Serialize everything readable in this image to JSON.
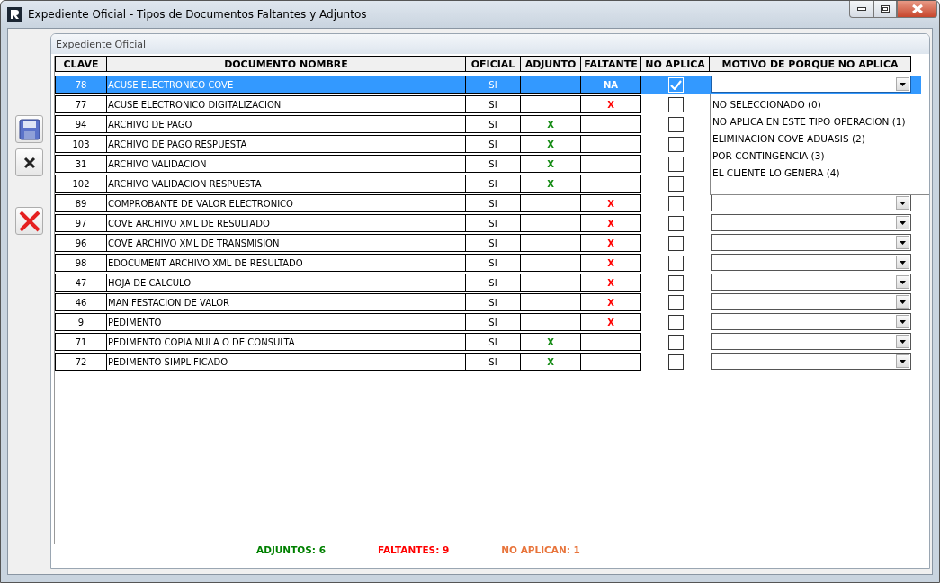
{
  "window": {
    "title": "Expediente Oficial - Tipos de Documentos Faltantes y Adjuntos"
  },
  "panel": {
    "title": "Expediente Oficial"
  },
  "table": {
    "columns": [
      "CLAVE",
      "DOCUMENTO NOMBRE",
      "OFICIAL",
      "ADJUNTO",
      "FALTANTE",
      "NO APLICA",
      "MOTIVO DE PORQUE NO APLICA"
    ],
    "rows": [
      {
        "clave": "78",
        "nombre": "ACUSE ELECTRONICO COVE",
        "oficial": "SI",
        "faltante": "NA",
        "no_aplica": true,
        "selected": true,
        "motivo": {
          "expanded": true,
          "options": [
            "NO SELECCIONADO (0)",
            "NO APLICA EN ESTE TIPO OPERACION (1)",
            "ELIMINACION COVE ADUASIS (2)",
            "POR CONTINGENCIA (3)",
            "EL CLIENTE LO GENERA (4)"
          ]
        }
      },
      {
        "clave": "77",
        "nombre": "ACUSE ELECTRONICO DIGITALIZACION",
        "oficial": "SI",
        "faltante": "X",
        "no_aplica": false,
        "selected": false
      },
      {
        "clave": "94",
        "nombre": "ARCHIVO DE PAGO",
        "oficial": "SI",
        "adjunto": "X",
        "no_aplica": false,
        "selected": false
      },
      {
        "clave": "103",
        "nombre": "ARCHIVO DE PAGO RESPUESTA",
        "oficial": "SI",
        "adjunto": "X",
        "no_aplica": false,
        "selected": false
      },
      {
        "clave": "31",
        "nombre": "ARCHIVO VALIDACION",
        "oficial": "SI",
        "adjunto": "X",
        "no_aplica": false,
        "selected": false
      },
      {
        "clave": "102",
        "nombre": "ARCHIVO VALIDACION RESPUESTA",
        "oficial": "SI",
        "adjunto": "X",
        "no_aplica": false,
        "selected": false
      },
      {
        "clave": "89",
        "nombre": "COMPROBANTE DE VALOR ELECTRONICO",
        "oficial": "SI",
        "faltante": "X",
        "no_aplica": false,
        "selected": false
      },
      {
        "clave": "97",
        "nombre": "COVE ARCHIVO XML DE RESULTADO",
        "oficial": "SI",
        "faltante": "X",
        "no_aplica": false,
        "selected": false
      },
      {
        "clave": "96",
        "nombre": "COVE ARCHIVO XML DE TRANSMISION",
        "oficial": "SI",
        "faltante": "X",
        "no_aplica": false,
        "selected": false
      },
      {
        "clave": "98",
        "nombre": "EDOCUMENT ARCHIVO XML DE RESULTADO",
        "oficial": "SI",
        "faltante": "X",
        "no_aplica": false,
        "selected": false
      },
      {
        "clave": "47",
        "nombre": "HOJA DE CALCULO",
        "oficial": "SI",
        "faltante": "X",
        "no_aplica": false,
        "selected": false
      },
      {
        "clave": "46",
        "nombre": "MANIFESTACION DE VALOR",
        "oficial": "SI",
        "faltante": "X",
        "no_aplica": false,
        "selected": false
      },
      {
        "clave": "9",
        "nombre": "PEDIMENTO",
        "oficial": "SI",
        "faltante": "X",
        "no_aplica": false,
        "selected": false
      },
      {
        "clave": "71",
        "nombre": "PEDIMENTO COPIA NULA O DE CONSULTA",
        "oficial": "SI",
        "adjunto": "X",
        "no_aplica": false,
        "selected": false
      },
      {
        "clave": "72",
        "nombre": "PEDIMENTO SIMPLIFICADO",
        "oficial": "SI",
        "adjunto": "X",
        "no_aplica": false,
        "selected": false
      }
    ]
  },
  "summary": [
    {
      "text": "ADJUNTOS: 6",
      "color": "#008000"
    },
    {
      "text": "FALTANTES: 9",
      "color": "#ff0000"
    },
    {
      "text": "NO APLICAN: 1",
      "color": "#e8743b"
    }
  ]
}
